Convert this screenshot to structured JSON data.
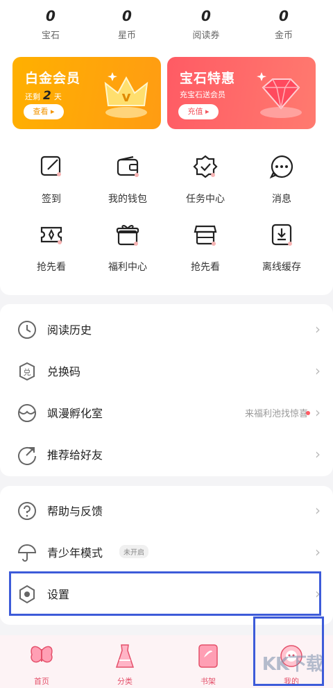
{
  "stats": [
    {
      "value": "0",
      "label": "宝石"
    },
    {
      "value": "0",
      "label": "星币"
    },
    {
      "value": "0",
      "label": "阅读券"
    },
    {
      "value": "0",
      "label": "金币"
    }
  ],
  "cards": {
    "platinum": {
      "title": "白金会员",
      "sub_prefix": "还剩",
      "days": "2",
      "sub_suffix": "天",
      "button": "查看"
    },
    "gem": {
      "title": "宝石特惠",
      "sub": "充宝石送会员",
      "button": "充值"
    }
  },
  "grid": [
    {
      "label": "签到",
      "icon": "edit-icon"
    },
    {
      "label": "我的钱包",
      "icon": "wallet-icon"
    },
    {
      "label": "任务中心",
      "icon": "badge-check-icon"
    },
    {
      "label": "消息",
      "icon": "message-icon"
    },
    {
      "label": "抢先看",
      "icon": "ticket-icon"
    },
    {
      "label": "福利中心",
      "icon": "gift-icon"
    },
    {
      "label": "抢先看",
      "icon": "store-icon"
    },
    {
      "label": "离线缓存",
      "icon": "download-icon"
    }
  ],
  "list1": [
    {
      "label": "阅读历史",
      "icon": "clock-icon"
    },
    {
      "label": "兑换码",
      "icon": "exchange-icon"
    },
    {
      "label": "飒漫孵化室",
      "icon": "incubator-icon",
      "hint": "来福利池找惊喜"
    },
    {
      "label": "推荐给好友",
      "icon": "share-icon"
    }
  ],
  "list2": [
    {
      "label": "帮助与反馈",
      "icon": "help-icon"
    },
    {
      "label": "青少年模式",
      "icon": "umbrella-icon",
      "badge": "未开启"
    },
    {
      "label": "设置",
      "icon": "settings-icon"
    }
  ],
  "nav": [
    {
      "label": "首页",
      "icon": "butterfly-icon"
    },
    {
      "label": "分类",
      "icon": "dress-icon"
    },
    {
      "label": "书架",
      "icon": "book-icon"
    },
    {
      "label": "我的",
      "icon": "profile-icon"
    }
  ],
  "watermark": "KK下载",
  "colors": {
    "accent": "#e4506a",
    "highlight": "#3d5bd9",
    "gold": "#ffb000",
    "gem": "#ff5b64"
  }
}
